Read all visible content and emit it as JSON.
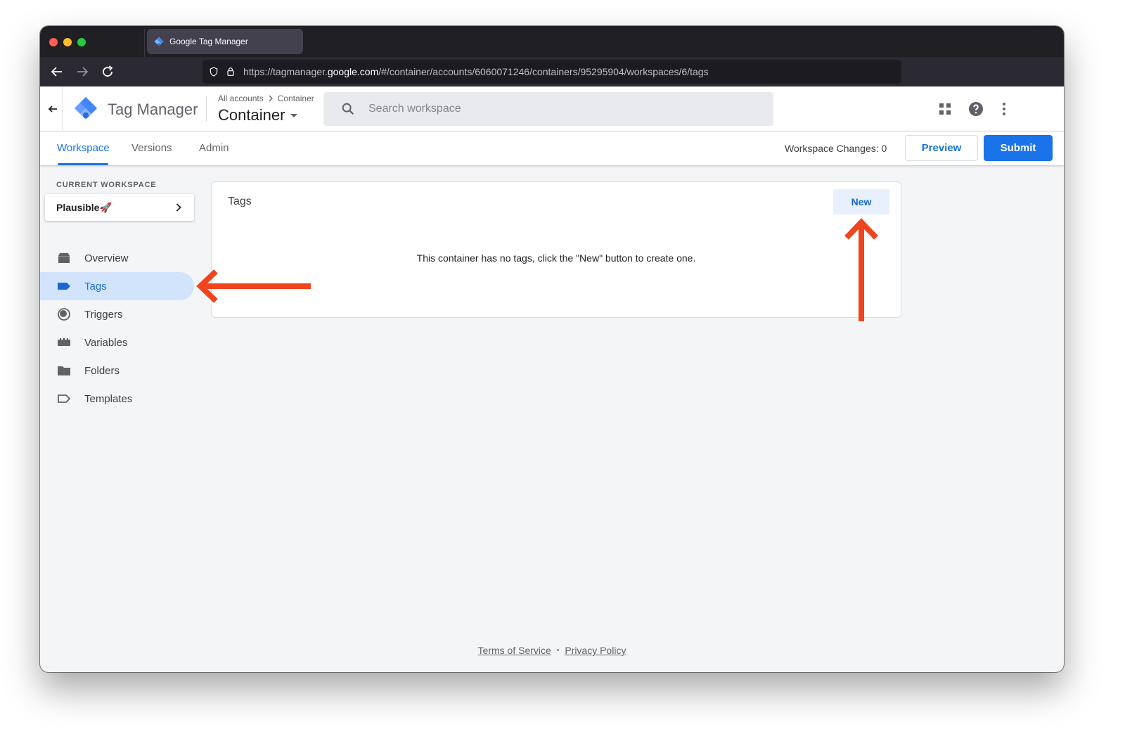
{
  "browser": {
    "tab_title": "Google Tag Manager",
    "url_prefix": "https://tagmanager.",
    "url_host": "google.com",
    "url_path": "/#/container/accounts/6060071246/containers/95295904/workspaces/6/tags"
  },
  "header": {
    "product_name": "Tag Manager",
    "breadcrumb_accounts": "All accounts",
    "breadcrumb_container": "Container",
    "container_name": "Container",
    "search_placeholder": "Search workspace"
  },
  "subnav": {
    "tabs": [
      {
        "label": "Workspace",
        "active": true
      },
      {
        "label": "Versions",
        "active": false
      },
      {
        "label": "Admin",
        "active": false
      }
    ],
    "workspace_changes": "Workspace Changes: 0",
    "preview_label": "Preview",
    "submit_label": "Submit"
  },
  "sidebar": {
    "current_workspace_label": "CURRENT WORKSPACE",
    "workspace_name": "Plausible🚀",
    "items": [
      {
        "label": "Overview",
        "icon": "overview-icon"
      },
      {
        "label": "Tags",
        "icon": "tag-icon",
        "active": true
      },
      {
        "label": "Triggers",
        "icon": "trigger-icon"
      },
      {
        "label": "Variables",
        "icon": "variables-icon"
      },
      {
        "label": "Folders",
        "icon": "folder-icon"
      },
      {
        "label": "Templates",
        "icon": "template-icon"
      }
    ]
  },
  "main": {
    "card_title": "Tags",
    "new_label": "New",
    "empty_message": "This container has no tags, click the \"New\" button to create one."
  },
  "footer": {
    "terms": "Terms of Service",
    "separator": "•",
    "privacy": "Privacy Policy"
  },
  "colors": {
    "accent": "#1a73e8",
    "annotation_arrow": "#f0441f",
    "active_nav_bg": "#d2e3fc"
  }
}
